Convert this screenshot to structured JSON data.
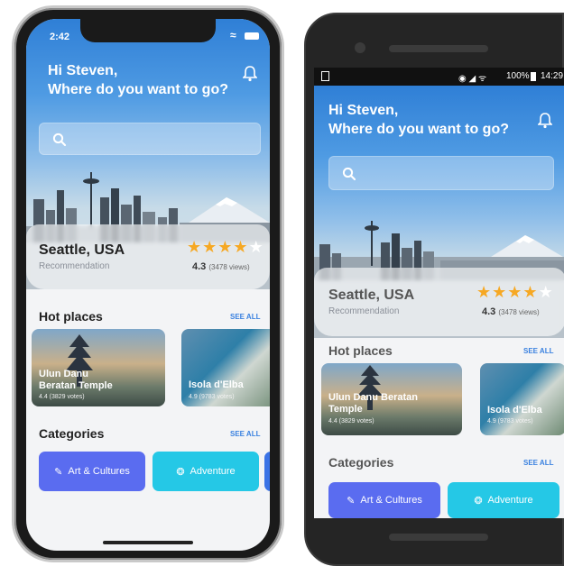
{
  "iphone": {
    "status_time": "2:42",
    "greeting_line1": "Hi Steven,",
    "greeting_line2": "Where do you want to go?",
    "search_placeholder": "",
    "recommendation": {
      "city": "Seattle, USA",
      "subtitle": "Recommendation",
      "rating": "4.3",
      "views": "(3478 views)",
      "stars_filled": 4,
      "stars_total": 5
    },
    "hot_places": {
      "title": "Hot places",
      "see_all": "SEE ALL",
      "items": [
        {
          "name_line1": "Ulun Danu",
          "name_line2": "Beratan Temple",
          "votes": "4.4 (3829 votes)"
        },
        {
          "name_line1": "Isola d'Elba",
          "name_line2": "",
          "votes": "4.9 (9783 votes)"
        }
      ]
    },
    "categories": {
      "title": "Categories",
      "see_all": "SEE ALL",
      "items": [
        {
          "label": "Art & Cultures",
          "icon": "paintbrush-icon"
        },
        {
          "label": "Adventure",
          "icon": "compass-icon"
        }
      ]
    }
  },
  "android": {
    "status_left_icon": "sim-icon",
    "status_right": "100%",
    "status_time": "14:29",
    "greeting_line1": "Hi Steven,",
    "greeting_line2": "Where do you want to go?",
    "search_placeholder": "",
    "recommendation": {
      "city": "Seattle, USA",
      "subtitle": "Recommendation",
      "rating": "4.3",
      "views": "(3478 views)",
      "stars_filled": 4,
      "stars_total": 5
    },
    "hot_places": {
      "title": "Hot places",
      "see_all": "SEE ALL",
      "items": [
        {
          "name_line1": "Ulun Danu Beratan",
          "name_line2": "Temple",
          "votes": "4.4 (3829 votes)"
        },
        {
          "name_line1": "Isola d'Elba",
          "name_line2": "",
          "votes": "4.9 (9783 votes)"
        }
      ]
    },
    "categories": {
      "title": "Categories",
      "see_all": "SEE ALL",
      "items": [
        {
          "label": "Art & Cultures",
          "icon": "paintbrush-icon"
        },
        {
          "label": "Adventure",
          "icon": "compass-icon"
        }
      ]
    }
  },
  "colors": {
    "accent_blue": "#3b82e0",
    "art_purple": "#5a6cf0",
    "adventure_cyan": "#25c8e6",
    "star_gold": "#f6a823"
  }
}
